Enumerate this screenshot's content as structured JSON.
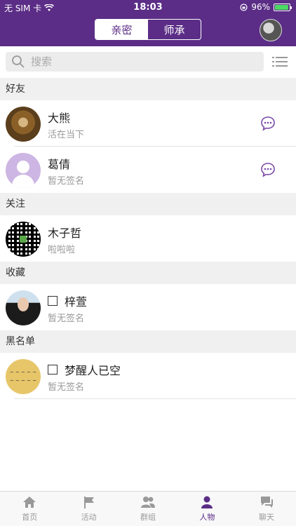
{
  "status_bar": {
    "carrier": "无 SIM 卡",
    "time": "18:03",
    "battery": "96%",
    "battery_level": 0.96
  },
  "header": {
    "segments": [
      {
        "label": "亲密",
        "active": true
      },
      {
        "label": "师承",
        "active": false
      }
    ],
    "avatar_icon": "user-avatar"
  },
  "search": {
    "placeholder": "搜索",
    "icon": "search-icon",
    "list_icon": "list-icon"
  },
  "sections": [
    {
      "title": "好友",
      "items": [
        {
          "name": "大熊",
          "signature": "活在当下",
          "checkbox": false,
          "chat": true
        },
        {
          "name": "葛倩",
          "signature": "暂无签名",
          "checkbox": false,
          "chat": true
        }
      ]
    },
    {
      "title": "关注",
      "items": [
        {
          "name": "木子哲",
          "signature": "啦啦啦",
          "checkbox": false,
          "chat": false
        }
      ]
    },
    {
      "title": "收藏",
      "items": [
        {
          "name": "梓萱",
          "signature": "暂无签名",
          "checkbox": true,
          "chat": false
        }
      ]
    },
    {
      "title": "黑名单",
      "items": [
        {
          "name": "梦醒人已空",
          "signature": "暂无签名",
          "checkbox": true,
          "chat": false
        }
      ]
    }
  ],
  "tabbar": {
    "items": [
      {
        "label": "首页",
        "icon": "home-icon",
        "active": false
      },
      {
        "label": "活动",
        "icon": "flag-icon",
        "active": false
      },
      {
        "label": "群组",
        "icon": "group-icon",
        "active": false
      },
      {
        "label": "人物",
        "icon": "person-icon",
        "active": true
      },
      {
        "label": "聊天",
        "icon": "chat-icon",
        "active": false
      }
    ]
  },
  "colors": {
    "brand": "#5b2d86",
    "accent": "#7a4aa6",
    "section_bg": "#f0f0f0"
  }
}
